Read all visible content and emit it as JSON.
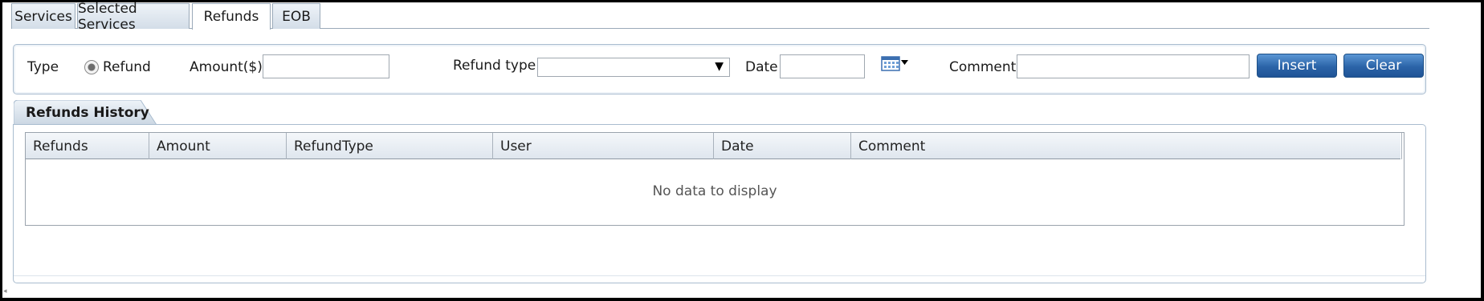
{
  "tabs": [
    {
      "label": "Services"
    },
    {
      "label": "Selected Services"
    },
    {
      "label": "Refunds",
      "active": true
    },
    {
      "label": "EOB"
    }
  ],
  "form": {
    "type_label": "Type",
    "radio_label": "Refund",
    "radio_selected": true,
    "amount_label": "Amount($)",
    "amount_value": "",
    "refund_type_label": "Refund type",
    "refund_type_value": "",
    "date_label": "Date",
    "date_value": "",
    "comment_label": "Comment",
    "comment_value": "",
    "insert_label": "Insert",
    "clear_label": "Clear"
  },
  "history": {
    "title": "Refunds History",
    "columns": [
      "Refunds",
      "Amount",
      "RefundType",
      "User",
      "Date",
      "Comment"
    ],
    "rows": [],
    "empty_text": "No data to display"
  },
  "icons": {
    "calendar": "calendar-icon",
    "dropdown": "chevron-down-icon"
  },
  "colors": {
    "button_blue": "#2b64a8",
    "panel_border": "#a9bccf",
    "tab_bg": "#d3dde8"
  }
}
